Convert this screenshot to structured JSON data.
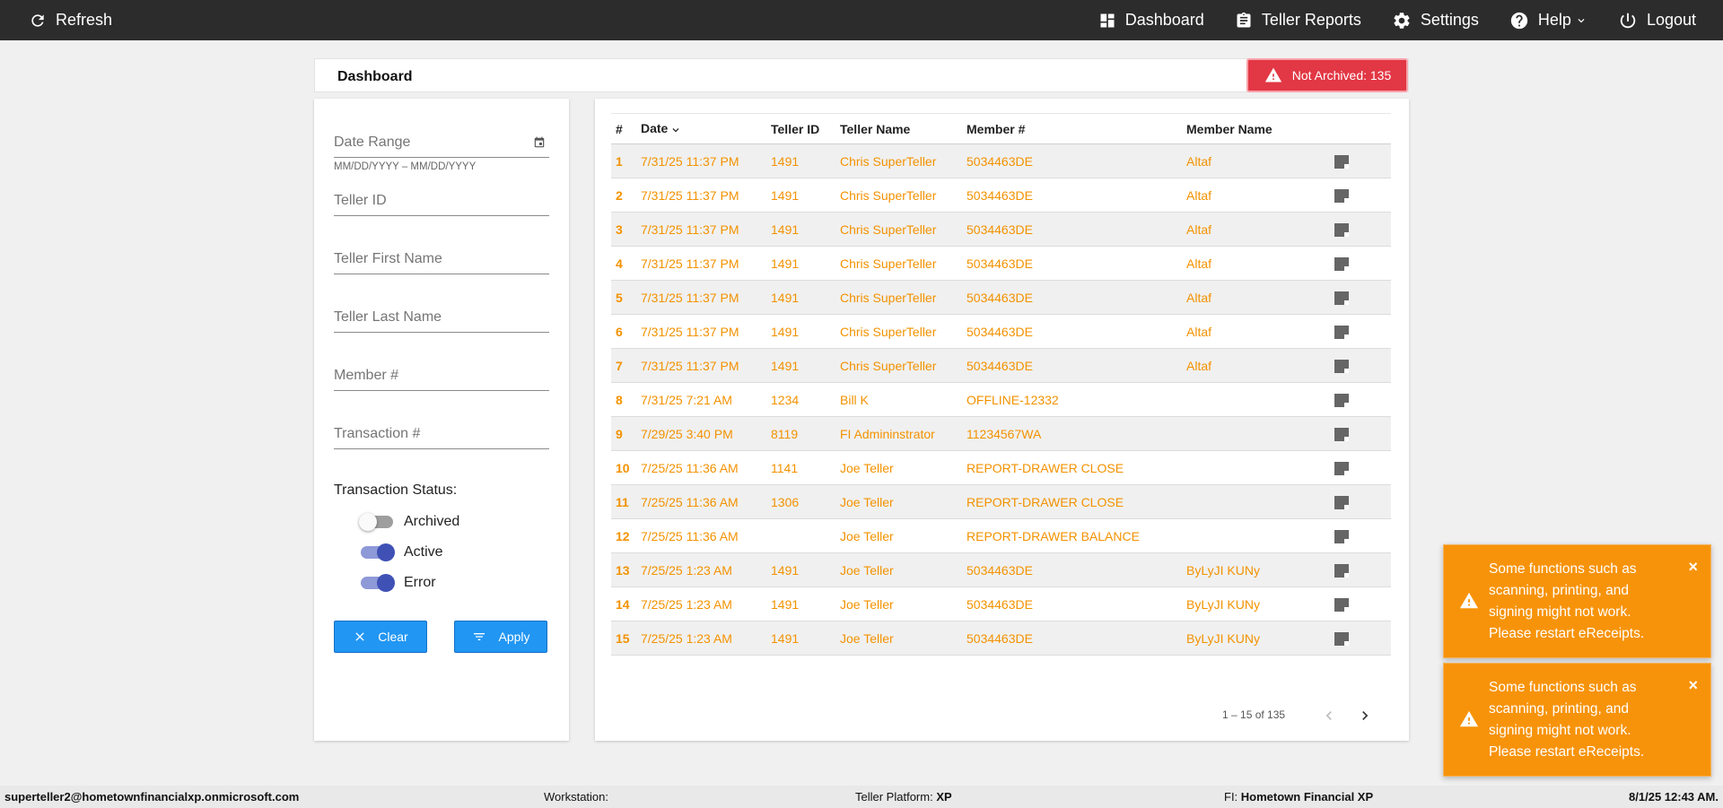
{
  "topbar": {
    "refresh_label": "Refresh",
    "nav": [
      {
        "label": "Dashboard"
      },
      {
        "label": "Teller Reports"
      },
      {
        "label": "Settings"
      },
      {
        "label": "Help"
      },
      {
        "label": "Logout"
      }
    ]
  },
  "dashboard": {
    "title": "Dashboard",
    "archived_badge": "Not Archived: 135"
  },
  "filters": {
    "date_range_placeholder": "Date Range",
    "date_hint": "MM/DD/YYYY – MM/DD/YYYY",
    "teller_id_placeholder": "Teller ID",
    "teller_first_placeholder": "Teller First Name",
    "teller_last_placeholder": "Teller Last Name",
    "member_placeholder": "Member #",
    "transaction_placeholder": "Transaction #",
    "status_label": "Transaction Status:",
    "statuses": [
      {
        "label": "Archived",
        "on": false
      },
      {
        "label": "Active",
        "on": true
      },
      {
        "label": "Error",
        "on": true
      }
    ],
    "clear_label": "Clear",
    "apply_label": "Apply"
  },
  "table": {
    "headers": [
      "#",
      "Date",
      "Teller ID",
      "Teller Name",
      "Member #",
      "Member Name",
      ""
    ],
    "rows": [
      {
        "num": "1",
        "date": "7/31/25 11:37 PM",
        "teller_id": "1491",
        "teller_name": "Chris SuperTeller",
        "member_no": "5034463DE",
        "member_name": "Altaf"
      },
      {
        "num": "2",
        "date": "7/31/25 11:37 PM",
        "teller_id": "1491",
        "teller_name": "Chris SuperTeller",
        "member_no": "5034463DE",
        "member_name": "Altaf"
      },
      {
        "num": "3",
        "date": "7/31/25 11:37 PM",
        "teller_id": "1491",
        "teller_name": "Chris SuperTeller",
        "member_no": "5034463DE",
        "member_name": "Altaf"
      },
      {
        "num": "4",
        "date": "7/31/25 11:37 PM",
        "teller_id": "1491",
        "teller_name": "Chris SuperTeller",
        "member_no": "5034463DE",
        "member_name": "Altaf"
      },
      {
        "num": "5",
        "date": "7/31/25 11:37 PM",
        "teller_id": "1491",
        "teller_name": "Chris SuperTeller",
        "member_no": "5034463DE",
        "member_name": "Altaf"
      },
      {
        "num": "6",
        "date": "7/31/25 11:37 PM",
        "teller_id": "1491",
        "teller_name": "Chris SuperTeller",
        "member_no": "5034463DE",
        "member_name": "Altaf"
      },
      {
        "num": "7",
        "date": "7/31/25 11:37 PM",
        "teller_id": "1491",
        "teller_name": "Chris SuperTeller",
        "member_no": "5034463DE",
        "member_name": "Altaf"
      },
      {
        "num": "8",
        "date": "7/31/25 7:21 AM",
        "teller_id": "1234",
        "teller_name": "Bill K",
        "member_no": "OFFLINE-12332",
        "member_name": ""
      },
      {
        "num": "9",
        "date": "7/29/25 3:40 PM",
        "teller_id": "8119",
        "teller_name": "FI Admininstrator",
        "member_no": "11234567WA",
        "member_name": ""
      },
      {
        "num": "10",
        "date": "7/25/25 11:36 AM",
        "teller_id": "1141",
        "teller_name": "Joe Teller",
        "member_no": "REPORT-DRAWER CLOSE",
        "member_name": ""
      },
      {
        "num": "11",
        "date": "7/25/25 11:36 AM",
        "teller_id": "1306",
        "teller_name": "Joe Teller",
        "member_no": "REPORT-DRAWER CLOSE",
        "member_name": ""
      },
      {
        "num": "12",
        "date": "7/25/25 11:36 AM",
        "teller_id": "",
        "teller_name": "Joe Teller",
        "member_no": "REPORT-DRAWER BALANCE",
        "member_name": ""
      },
      {
        "num": "13",
        "date": "7/25/25 1:23 AM",
        "teller_id": "1491",
        "teller_name": "Joe Teller",
        "member_no": "5034463DE",
        "member_name": "ByLyJI KUNy"
      },
      {
        "num": "14",
        "date": "7/25/25 1:23 AM",
        "teller_id": "1491",
        "teller_name": "Joe Teller",
        "member_no": "5034463DE",
        "member_name": "ByLyJI KUNy"
      },
      {
        "num": "15",
        "date": "7/25/25 1:23 AM",
        "teller_id": "1491",
        "teller_name": "Joe Teller",
        "member_no": "5034463DE",
        "member_name": "ByLyJI KUNy"
      }
    ],
    "pagination": "1 – 15 of 135"
  },
  "toasts": [
    {
      "message": "Some functions such as scanning, printing, and signing might not work. Please restart eReceipts.",
      "close": "×"
    },
    {
      "message": "Some functions such as scanning, printing, and signing might not work. Please restart eReceipts.",
      "close": "×"
    }
  ],
  "statusbar": {
    "user": "superteller2@hometownfinancialxp.onmicrosoft.com",
    "workstation_label": "Workstation:",
    "workstation_value": "",
    "platform_label": "Teller Platform:",
    "platform_value": "XP",
    "fi_label": "FI:",
    "fi_value": "Hometown Financial XP",
    "datetime": "8/1/25 12:43 AM."
  },
  "colors": {
    "topbar": "#2c2c2c",
    "row_text": "#f39200",
    "badge": "#e23744",
    "toast": "#f7930a",
    "button": "#2196f3",
    "toggle_on": "#3f51b5"
  }
}
